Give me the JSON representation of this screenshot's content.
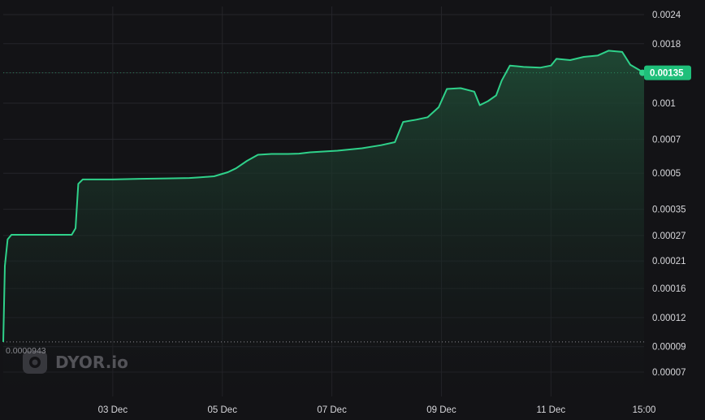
{
  "chart_data": {
    "type": "area",
    "y_scale": "log",
    "grid": true,
    "y_ticks": [
      "0.0024",
      "0.0018",
      "0.00135",
      "0.001",
      "0.0007",
      "0.0005",
      "0.00035",
      "0.00027",
      "0.00021",
      "0.00016",
      "0.00012",
      "0.00009",
      "0.00007"
    ],
    "x_ticks": [
      "03 Dec",
      "05 Dec",
      "07 Dec",
      "09 Dec",
      "11 Dec",
      "15:00"
    ],
    "current_price": "0.00135",
    "min_label": "0.0000943",
    "x_range_days": [
      1.0,
      12.7
    ],
    "ylim": [
      5.5e-05,
      0.0026
    ],
    "series": [
      {
        "values": [
          [
            1.0,
            9.43e-05
          ],
          [
            1.03,
            0.0002
          ],
          [
            1.08,
            0.00026
          ],
          [
            1.15,
            0.000272
          ],
          [
            2.0,
            0.000272
          ],
          [
            2.15,
            0.000272
          ],
          [
            2.25,
            0.000272
          ],
          [
            2.32,
            0.00029
          ],
          [
            2.37,
            0.00045
          ],
          [
            2.45,
            0.00047
          ],
          [
            3.0,
            0.00047
          ],
          [
            3.5,
            0.000473
          ],
          [
            4.0,
            0.000475
          ],
          [
            4.4,
            0.000477
          ],
          [
            4.6,
            0.00048
          ],
          [
            4.85,
            0.000485
          ],
          [
            5.1,
            0.000505
          ],
          [
            5.25,
            0.000525
          ],
          [
            5.45,
            0.000565
          ],
          [
            5.65,
            0.0006
          ],
          [
            5.9,
            0.000605
          ],
          [
            6.2,
            0.000605
          ],
          [
            6.4,
            0.000607
          ],
          [
            6.6,
            0.000615
          ],
          [
            6.85,
            0.00062
          ],
          [
            7.1,
            0.000625
          ],
          [
            7.55,
            0.00064
          ],
          [
            7.9,
            0.00066
          ],
          [
            8.15,
            0.00068
          ],
          [
            8.3,
            0.00083
          ],
          [
            8.55,
            0.00085
          ],
          [
            8.75,
            0.00087
          ],
          [
            8.95,
            0.00096
          ],
          [
            9.1,
            0.00115
          ],
          [
            9.35,
            0.00116
          ],
          [
            9.6,
            0.00112
          ],
          [
            9.7,
            0.00098
          ],
          [
            9.85,
            0.00102
          ],
          [
            10.0,
            0.00108
          ],
          [
            10.1,
            0.00125
          ],
          [
            10.25,
            0.00145
          ],
          [
            10.5,
            0.00143
          ],
          [
            10.8,
            0.00142
          ],
          [
            11.0,
            0.00145
          ],
          [
            11.1,
            0.00155
          ],
          [
            11.35,
            0.00153
          ],
          [
            11.6,
            0.00158
          ],
          [
            11.85,
            0.0016
          ],
          [
            12.05,
            0.00168
          ],
          [
            12.3,
            0.00166
          ],
          [
            12.45,
            0.00146
          ],
          [
            12.7,
            0.00135
          ]
        ]
      }
    ]
  },
  "watermark": {
    "text": "DYOR.io",
    "icon": "dyor-logo-icon"
  },
  "colors": {
    "background": "#131316",
    "grid": "#25252a",
    "line": "#2fd18a",
    "area_top": "#1f4a35",
    "area_bottom": "#131316",
    "price_tag": "#1fbf7a",
    "min_line": "#8a8a90"
  }
}
